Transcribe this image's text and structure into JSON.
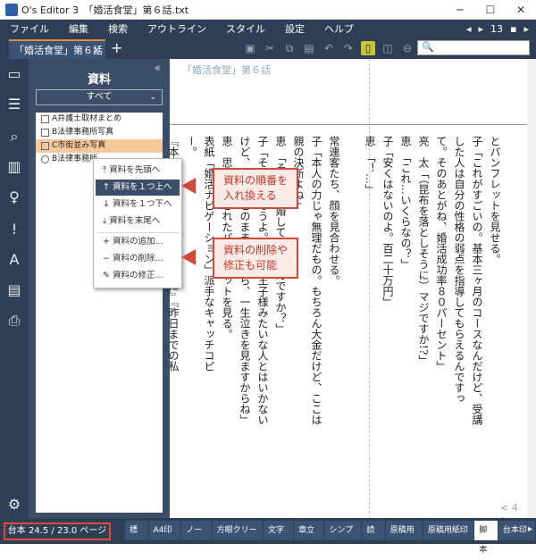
{
  "window": {
    "title": "O's Editor 3　「婚活食堂」第６話.txt",
    "controls": [
      "─",
      "☐",
      "✕"
    ]
  },
  "menu": {
    "items": [
      "ファイル",
      "編集",
      "検索",
      "アウトライン",
      "スタイル",
      "設定",
      "ヘルプ"
    ],
    "right": [
      "◂",
      "▸",
      "13",
      "▪",
      "▸"
    ]
  },
  "tab": {
    "label": "「婚活食堂」第６話",
    "close": "✕",
    "add": "+"
  },
  "toolbar": {
    "icons": [
      "save-icon",
      "cut-icon",
      "copy-icon",
      "paste-icon",
      "undo-icon",
      "redo-icon",
      "ruby-icon",
      "mark-icon",
      "disabled-icon"
    ]
  },
  "search": {
    "icon": "🔍",
    "placeholder": ""
  },
  "sidebar": {
    "icons": [
      "folder-icon",
      "outline-icon",
      "search-icon",
      "books-icon",
      "figure-icon",
      "exclaim-icon",
      "font-size-icon",
      "pdf-icon",
      "print-icon",
      "settings-icon"
    ]
  },
  "panel": {
    "title": "資料",
    "filter": "すべて",
    "items": [
      {
        "label": "A弁護士取材まとめ",
        "selected": false
      },
      {
        "label": "B法律事務所写真",
        "selected": false
      },
      {
        "label": "C市街並み写真",
        "selected": true
      },
      {
        "label": "B法律事務所",
        "selected": false
      }
    ]
  },
  "context_menu": {
    "items": [
      {
        "icon": "⤒",
        "label": "資料を先頭へ",
        "highlight": false
      },
      {
        "icon": "↑",
        "label": "資料を１つ上へ",
        "highlight": true
      },
      {
        "icon": "↓",
        "label": "資料を１つ下へ",
        "highlight": false
      },
      {
        "icon": "⤓",
        "label": "資料を末尾へ",
        "highlight": false
      },
      {
        "icon": "+",
        "label": "資料の追加...",
        "highlight": false
      },
      {
        "icon": "−",
        "label": "資料の削除...",
        "highlight": false
      },
      {
        "icon": "✎",
        "label": "資料の修正...",
        "highlight": false
      }
    ]
  },
  "callouts": {
    "c1": [
      "資料の順番を",
      "入れ換える"
    ],
    "c2": [
      "資料の削除や",
      "修正も可能"
    ]
  },
  "editor": {
    "header": "「婚活食堂」第６話",
    "page_indicator": "< 4 >",
    "columns": [
      "とパンフレットを見せる。",
      "子「これがすごいの。基本三ヶ月のコースなんだけど、受講",
      "した人は自分の性格の弱点を指導してもらえるんですっ",
      "て。そのあとがね、婚活成功率８０パーセント」",
      "亮　太「（昆布を落としそうに）マジですか!?」",
      "恵　「これ…いくらなの？」",
      "子「安くはないのよ。百二十万円」",
      "恵　「！…」",
      "",
      "常連客たち、顔を見合わせる。",
      "子「本人の力じゃ無理だもの。もちろん大金だけど、ここは",
      "親の決断よね」",
      "恵　「そんな結婚してほしいんですか？」",
      "子「そりゃ、そうよ。息子は王子様みたいな人とはいかない",
      "けど、もし、このままだったら、一生泣きを見ますからね」",
      "恵　思い、渡されたパンフレットを見る。",
      "表紙「婚活ナビゲーション」派手なキャッチコピ",
      "ー。",
      "『本当の自分になる』『０を１に』『昨日までの私"
    ]
  },
  "status": {
    "pages": "台本 24.5 / 23.0 ページ",
    "tabs": [
      {
        "label": "標準",
        "active": false
      },
      {
        "label": "A4印刷",
        "active": false
      },
      {
        "label": "ノート",
        "active": false
      },
      {
        "label": "方眼クリーム",
        "active": false
      },
      {
        "label": "文字数",
        "active": false
      },
      {
        "label": "章立て",
        "active": false
      },
      {
        "label": "シンプル",
        "active": false
      },
      {
        "label": "読書",
        "active": false
      },
      {
        "label": "原稿用紙",
        "active": false
      },
      {
        "label": "原稿用紙印刷",
        "active": false
      },
      {
        "label": "脚本",
        "active": true
      },
      {
        "label": "台本印刷",
        "active": false
      }
    ],
    "arrow": "▸"
  }
}
